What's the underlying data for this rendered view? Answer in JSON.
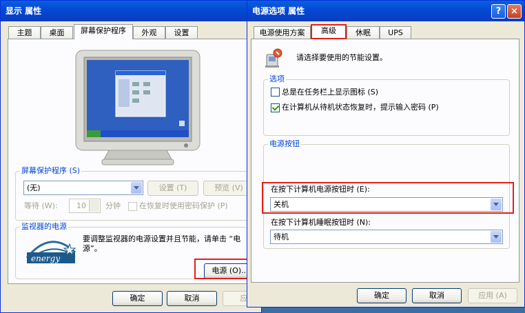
{
  "display_dialog": {
    "title": "显示 属性",
    "tabs": [
      "主题",
      "桌面",
      "屏幕保护程序",
      "外观",
      "设置"
    ],
    "screensaver_group": {
      "title": "屏幕保护程序 (S)",
      "selected": "(无)",
      "settings_button": "设置 (T)",
      "preview_button": "预览 (V)",
      "wait_label": "等待 (W):",
      "wait_value": "10",
      "minutes_label": "分钟",
      "password_checkbox": "在恢复时使用密码保护 (P)"
    },
    "monitor_power_group": {
      "title": "监视器的电源",
      "description": "要调整监视器的电源设置并且节能，请单击 “电源”。",
      "power_button": "电源 (O)..."
    },
    "footer": {
      "ok": "确定",
      "cancel": "取消",
      "apply": "应用"
    }
  },
  "power_dialog": {
    "title": "电源选项 属性",
    "help_button": "?",
    "close_button": "×",
    "tabs": [
      "电源使用方案",
      "高级",
      "休眠",
      "UPS"
    ],
    "intro_text": "请选择要使用的节能设置。",
    "options_group": {
      "title": "选项",
      "always_show_icon": "总是在任务栏上显示图标 (S)",
      "always_show_icon_checked": false,
      "prompt_password": "在计算机从待机状态恢复时，提示输入密码 (P)",
      "prompt_password_checked": true
    },
    "power_buttons_group": {
      "title": "电源按钮",
      "power_button_label": "在按下计算机电源按钮时 (E):",
      "power_button_value": "关机",
      "sleep_button_label": "在按下计算机睡眠按钮时 (N):",
      "sleep_button_value": "待机"
    },
    "footer": {
      "ok": "确定",
      "cancel": "取消",
      "apply": "应用 (A)"
    }
  },
  "energy_logo_text": "energy",
  "colors": {
    "highlight_red": "#e0201b",
    "xp_blue": "#0349d3",
    "group_title_blue": "#0046d5"
  }
}
